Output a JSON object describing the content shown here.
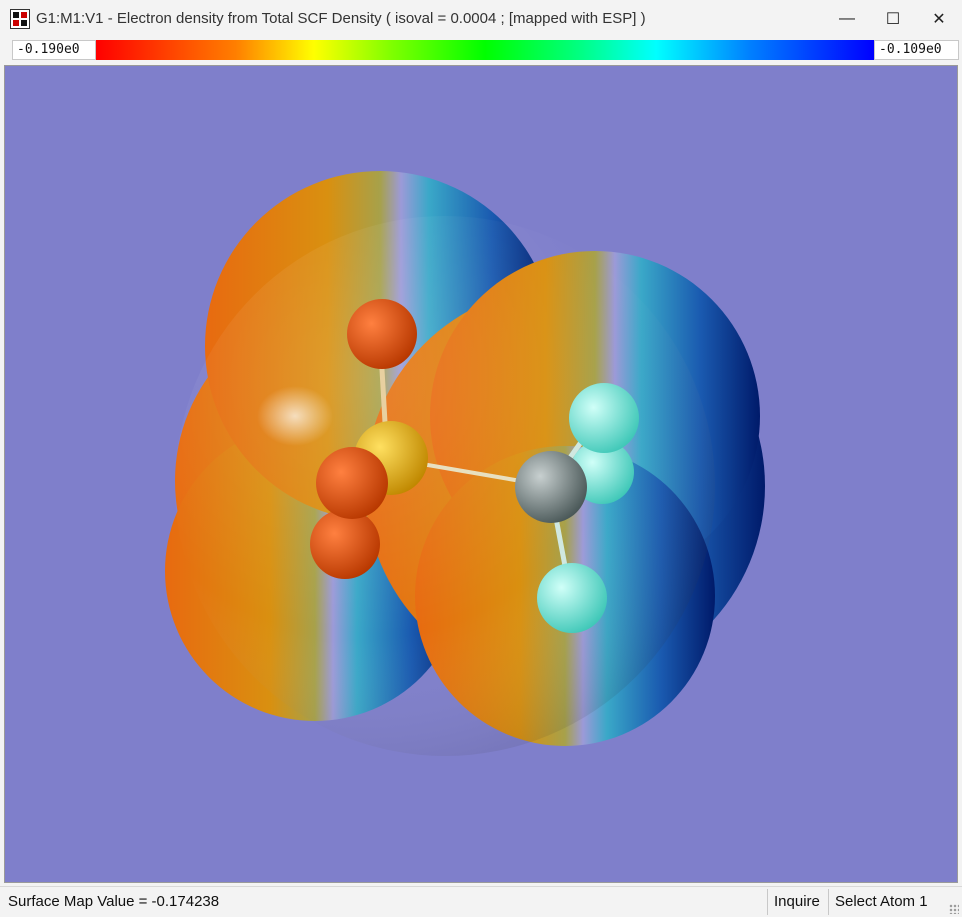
{
  "window": {
    "title": "G1:M1:V1 - Electron density from Total SCF Density ( isoval = 0.0004 ; [mapped with ESP] )",
    "controls": {
      "minimize": "—",
      "maximize": "☐",
      "close": "✕"
    }
  },
  "colorbar": {
    "min_label": "-0.190e0",
    "max_label": "-0.109e0",
    "gradient_colors": [
      "#ff0000",
      "#ff7f00",
      "#ffff00",
      "#00ff00",
      "#00ffff",
      "#0000ff"
    ]
  },
  "viewport": {
    "background": "#7f7fcb",
    "atoms": [
      {
        "element": "O",
        "color": "#e8500e"
      },
      {
        "element": "S",
        "color": "#f0b800"
      },
      {
        "element": "O",
        "color": "#e8500e"
      },
      {
        "element": "O",
        "color": "#e8500e"
      },
      {
        "element": "C",
        "color": "#7a8a8a"
      },
      {
        "element": "H",
        "color": "#80f0e0"
      },
      {
        "element": "H",
        "color": "#80f0e0"
      },
      {
        "element": "H",
        "color": "#80f0e0"
      }
    ]
  },
  "statusbar": {
    "surface_value_text": "Surface Map Value = -0.174238",
    "mode": "Inquire",
    "action": "Select Atom 1"
  }
}
